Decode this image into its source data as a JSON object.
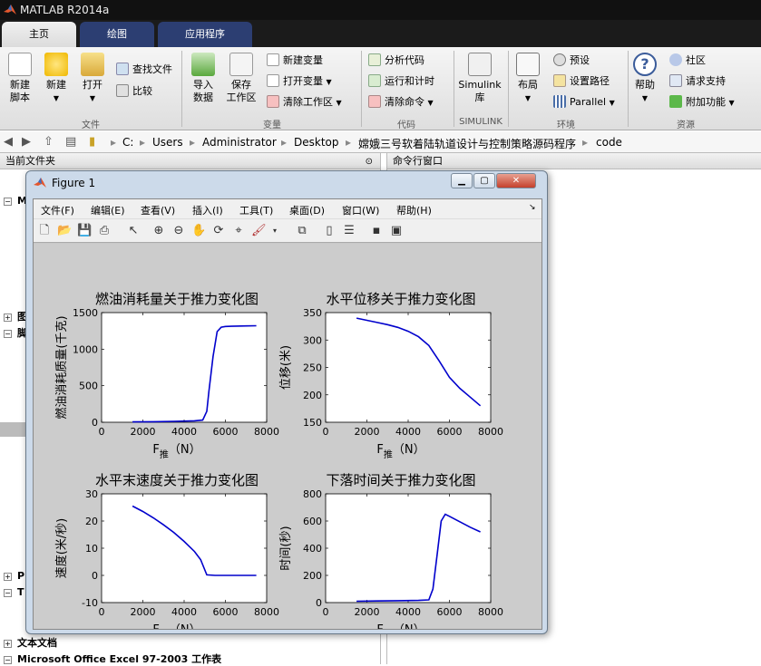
{
  "app": {
    "title": "MATLAB R2014a"
  },
  "tabs": [
    {
      "label": "主页"
    },
    {
      "label": "绘图"
    },
    {
      "label": "应用程序"
    }
  ],
  "ribbon": {
    "file": {
      "new_script": "新建\n脚本",
      "new": "新建",
      "open": "打开",
      "find_files": "查找文件",
      "compare": "比较",
      "group": "文件"
    },
    "variable": {
      "import": "导入\n数据",
      "save_ws": "保存\n工作区",
      "new_var": "新建变量",
      "open_var": "打开变量",
      "clear_ws": "清除工作区",
      "group": "变量"
    },
    "code": {
      "analyze": "分析代码",
      "run_time": "运行和计时",
      "clear_cmd": "清除命令",
      "group": "代码"
    },
    "simulink": {
      "lib": "Simulink\n库",
      "group": "SIMULINK"
    },
    "env": {
      "layout": "布局",
      "prefs": "预设",
      "set_path": "设置路径",
      "parallel": "Parallel",
      "group": "环境"
    },
    "resources": {
      "help": "帮助",
      "community": "社区",
      "support": "请求支持",
      "addons": "附加功能",
      "group": "资源"
    }
  },
  "address": {
    "crumbs": [
      "C:",
      "Users",
      "Administrator",
      "Desktop",
      "嫦娥三号软着陆轨道设计与控制策略源码程序",
      "code"
    ]
  },
  "left_panel": {
    "header": "当前文件夹",
    "items": [
      {
        "label": "M"
      },
      {
        "label": "图"
      },
      {
        "label": "脚"
      },
      {
        "label": "P"
      },
      {
        "label": "T"
      },
      {
        "label": "文本文档"
      },
      {
        "label": "Microsoft Office Excel 97-2003 工作表"
      }
    ]
  },
  "cmd_panel": {
    "header": "命令行窗口"
  },
  "figure": {
    "title": "Figure 1",
    "menu": [
      "文件(F)",
      "编辑(E)",
      "查看(V)",
      "插入(I)",
      "工具(T)",
      "桌面(D)",
      "窗口(W)",
      "帮助(H)"
    ]
  },
  "chart_data": [
    {
      "type": "line",
      "title": "燃油消耗量关于推力变化图",
      "xlabel": "F推（N）",
      "ylabel": "燃油消耗质量(千克)",
      "xlim": [
        0,
        8000
      ],
      "ylim": [
        0,
        1500
      ],
      "xticks": [
        0,
        2000,
        4000,
        6000,
        8000
      ],
      "yticks": [
        0,
        500,
        1000,
        1500
      ],
      "color": "#0000cc",
      "x": [
        1500,
        2500,
        3500,
        4500,
        4900,
        5100,
        5200,
        5400,
        5600,
        5800,
        6000,
        6500,
        7000,
        7500
      ],
      "y": [
        5,
        8,
        12,
        20,
        30,
        150,
        420,
        900,
        1240,
        1300,
        1310,
        1315,
        1318,
        1320
      ]
    },
    {
      "type": "line",
      "title": "水平位移关于推力变化图",
      "xlabel": "F推（N）",
      "ylabel": "位移(米)",
      "xlim": [
        0,
        8000
      ],
      "ylim": [
        150,
        350
      ],
      "xticks": [
        0,
        2000,
        4000,
        6000,
        8000
      ],
      "yticks": [
        150,
        200,
        250,
        300,
        350
      ],
      "color": "#0000cc",
      "x": [
        1500,
        2000,
        2500,
        3000,
        3500,
        4000,
        4500,
        5000,
        5500,
        6000,
        6500,
        7000,
        7500
      ],
      "y": [
        340,
        336,
        332,
        328,
        323,
        316,
        306,
        290,
        262,
        232,
        212,
        196,
        180
      ]
    },
    {
      "type": "line",
      "title": "水平末速度关于推力变化图",
      "xlabel": "F推（N）",
      "ylabel": "速度(米/秒)",
      "xlim": [
        0,
        8000
      ],
      "ylim": [
        -10,
        30
      ],
      "xticks": [
        0,
        2000,
        4000,
        6000,
        8000
      ],
      "yticks": [
        -10,
        0,
        10,
        20,
        30
      ],
      "color": "#0000cc",
      "x": [
        1500,
        2000,
        2500,
        3000,
        3500,
        4000,
        4500,
        4800,
        5100,
        5500,
        6000,
        6500,
        7000,
        7500
      ],
      "y": [
        25.5,
        23.5,
        21.2,
        18.6,
        15.8,
        12.5,
        8.8,
        5.8,
        0.2,
        0,
        0,
        0,
        0,
        0
      ]
    },
    {
      "type": "line",
      "title": "下落时间关于推力变化图",
      "xlabel": "F推（N）",
      "ylabel": "时间(秒)",
      "xlim": [
        0,
        8000
      ],
      "ylim": [
        0,
        800
      ],
      "xticks": [
        0,
        2000,
        4000,
        6000,
        8000
      ],
      "yticks": [
        0,
        200,
        400,
        600,
        800
      ],
      "color": "#0000cc",
      "x": [
        1500,
        2500,
        3500,
        4500,
        5000,
        5200,
        5400,
        5600,
        5800,
        6000,
        6500,
        7000,
        7500
      ],
      "y": [
        10,
        12,
        14,
        16,
        20,
        100,
        350,
        600,
        650,
        635,
        595,
        555,
        520
      ]
    }
  ]
}
